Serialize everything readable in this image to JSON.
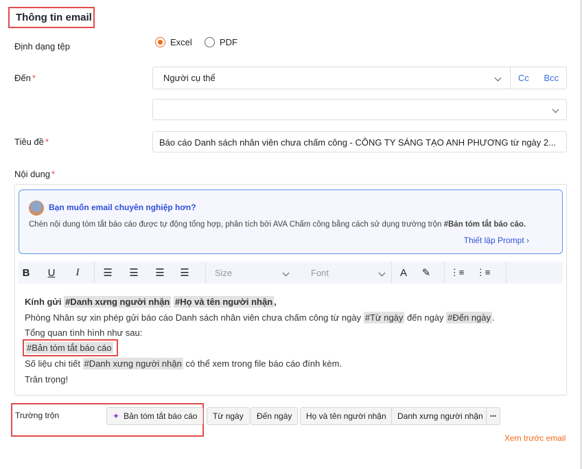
{
  "section_title": "Thông tin email",
  "file_format": {
    "label": "Định dạng tệp",
    "options": [
      "Excel",
      "PDF"
    ],
    "selected": "Excel"
  },
  "to": {
    "label": "Đến",
    "required": "*",
    "value": "Người cụ thể",
    "cc": "Cc",
    "bcc": "Bcc",
    "second_value": ""
  },
  "subject": {
    "label": "Tiêu đề",
    "required": "*",
    "value": "Báo cáo Danh sách nhân viên chưa chấm công - CÔNG TY SÁNG TẠO ANH PHƯƠNG từ ngày 2..."
  },
  "content": {
    "label": "Nội dung",
    "required": "*"
  },
  "banner": {
    "title": "Bạn muốn email chuyên nghiệp hơn?",
    "text": "Chèn nội dung tóm tắt báo cáo được tự động tổng hợp, phân tích bởi AVA Chấm công bằng cách sử dụng trường trộn ",
    "text_bold": "#Bản tóm tắt báo cáo.",
    "link": "Thiết lập Prompt"
  },
  "toolbar": {
    "bold": "B",
    "underline": "U",
    "italic": "I",
    "size": "Size",
    "font": "Font",
    "font_color": "A"
  },
  "body": {
    "l1_prefix": "Kính gửi ",
    "l1_tag1": "#Danh xưng người nhận",
    "l1_tag2": "#Họ và tên người nhận",
    "l1_suffix": ",",
    "l2_prefix": "Phòng Nhân sự xin phép gửi báo cáo Danh sách nhân viên chưa chấm công từ ngày ",
    "l2_tag1": "#Từ ngày",
    "l2_mid": " đến ngày ",
    "l2_tag2": "#Đến ngày",
    "l2_suffix": ".",
    "l3": "Tổng quan tình hình như sau:",
    "l4_tag": "#Bản tóm tắt báo cáo",
    "l5_prefix": "Số liệu chi tiết ",
    "l5_tag": "#Danh xưng người nhận",
    "l5_suffix": " có thể xem trong file báo cáo đính kèm.",
    "l6": "Trân trọng!"
  },
  "merge_fields": {
    "label": "Trường trộn",
    "items": [
      "Bản tóm tắt báo cáo",
      "Từ ngày",
      "Đến ngày",
      "Họ và tên người nhận",
      "Danh xưng người nhận"
    ],
    "more": "•••"
  },
  "preview_link": "Xem trước email",
  "colors": {
    "accent": "#f26a16",
    "link": "#3b6fe0",
    "highlight": "#e34b4b"
  }
}
